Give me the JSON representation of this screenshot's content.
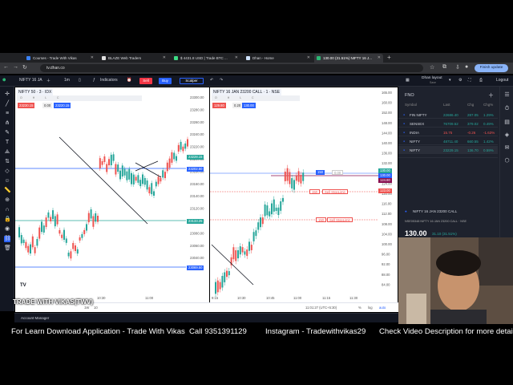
{
  "browser": {
    "tabs": [
      {
        "title": "Courses - Trade With Vikas",
        "active": false,
        "favicon_color": "#3b82f6"
      },
      {
        "title": "BLAZE Web Traders",
        "active": false,
        "favicon_color": "#e0e0e0"
      },
      {
        "title": "$ 4431.8 USD | Trade BTC ...",
        "active": false,
        "favicon_color": "#3ddc84"
      },
      {
        "title": "Dhan - Home",
        "active": false,
        "favicon_color": "#cfe3ff"
      },
      {
        "title": "130.00 (31.51%) NIFTY 16 J...",
        "active": true,
        "favicon_color": "#2bb673"
      }
    ],
    "new_tab": "+",
    "url": "tv.dhan.co",
    "update_button": "Finish update"
  },
  "toolbar": {
    "symbol": "NIFTY 16 JA",
    "interval": "1m",
    "indicators": "Indicators",
    "sell": "Sell",
    "buy": "Buy",
    "scalper": "Scalper",
    "layout_name": "Dhan layout",
    "layout_sub": "Save",
    "logout": "Logout"
  },
  "left_chart": {
    "title": "NIFTY 50 · 3 · IDX",
    "ohlc_labels": "O H L C",
    "price_bid": "23230.15",
    "spread": "0.00",
    "price_ask": "23220.15",
    "axis": [
      "23300.00",
      "23280.00",
      "23260.00",
      "23240.00",
      "23220.00",
      "23200.00",
      "23180.00",
      "23160.00",
      "23140.00",
      "23120.00",
      "23100.00",
      "23080.00",
      "23060.00",
      "23040.00"
    ],
    "badge_current": "23228.15",
    "badge_line1": "23202.50",
    "badge_line2": "23133.25",
    "badge_line3": "23069.50",
    "time_labels": [
      "10:30",
      "11:00"
    ],
    "logo": "TV"
  },
  "right_chart": {
    "title": "NIFTY 16 JAN 23200 CALL · 1 · NSE",
    "ohlc_labels": "O H L C",
    "price_bid": "129.80",
    "spread": "0.20",
    "price_ask": "130.00",
    "axis": [
      "165.00",
      "160.00",
      "152.00",
      "148.00",
      "144.00",
      "140.00",
      "136.00",
      "132.00",
      "128.00",
      "124.00",
      "120.00",
      "116.00",
      "112.00",
      "108.00",
      "104.00",
      "100.00",
      "96.00",
      "92.00",
      "88.00",
      "84.00"
    ],
    "badge_current": "130.00",
    "badge_a": "130.00",
    "badge_b": "124.80",
    "badge_c": "123.00",
    "order1_qty": "150",
    "order1_price": "0.00",
    "order2_qty": "150",
    "order2_label": "Sell StopLimit",
    "order3_qty": "150",
    "order3_label": "Sell StopLimit",
    "time_labels": [
      "9:15",
      "10:30",
      "10:45",
      "11:00",
      "11:15",
      "11:30"
    ],
    "clock": "11:01:27 (UTC+5:30)",
    "pct": "%",
    "log": "log",
    "auto": "auto"
  },
  "range_bar": {
    "items": [
      "1D",
      "5D",
      "1M",
      "3M",
      "6M",
      "YTD",
      "1Y",
      "5Y",
      "1W",
      "10"
    ]
  },
  "watchlist": {
    "title": "FNO",
    "columns": [
      "Symbol",
      "Last",
      "Chg",
      "Chg%"
    ],
    "rows": [
      {
        "symbol": "FIN NIFTY",
        "last": "22686.40",
        "chg": "287.05",
        "pct": "1.29%",
        "color": "#26a69a"
      },
      {
        "symbol": "SENSEX",
        "last": "76709.52",
        "chg": "379.02",
        "pct": "0.49%",
        "color": "#26a69a"
      },
      {
        "symbol": "INDIA",
        "last": "15.75",
        "chg": "-0.26",
        "pct": "-1.63%",
        "color": "#ef5350"
      },
      {
        "symbol": "NIFTY",
        "last": "48711.40",
        "chg": "660.55",
        "pct": "1.42%",
        "color": "#26a69a"
      },
      {
        "symbol": "NIFTY",
        "last": "23229.15",
        "chg": "136.70",
        "pct": "0.59%",
        "color": "#26a69a"
      }
    ]
  },
  "order_panel": {
    "symbol": "NIFTY 16 JAN 23200 CALL",
    "detail": "NSE05348 NIFTY 16 JAN 23200 CALL · NSE",
    "price": "130.00",
    "change": "31.10 (31.51%)",
    "status": "MARKET OPEN"
  },
  "account": {
    "label": "Account Manager"
  },
  "watermark": "TRADE WITH VIKAS(TWV)",
  "caption": {
    "text1": "For Learn Download Application - Trade With Vikas",
    "text2": "Call  9351391129",
    "text3": "Instagram -  Tradewithvikas29",
    "text4": "Check Video Description for more details"
  },
  "colors": {
    "up": "#26a69a",
    "down": "#ef5350",
    "accent": "#2962ff"
  }
}
